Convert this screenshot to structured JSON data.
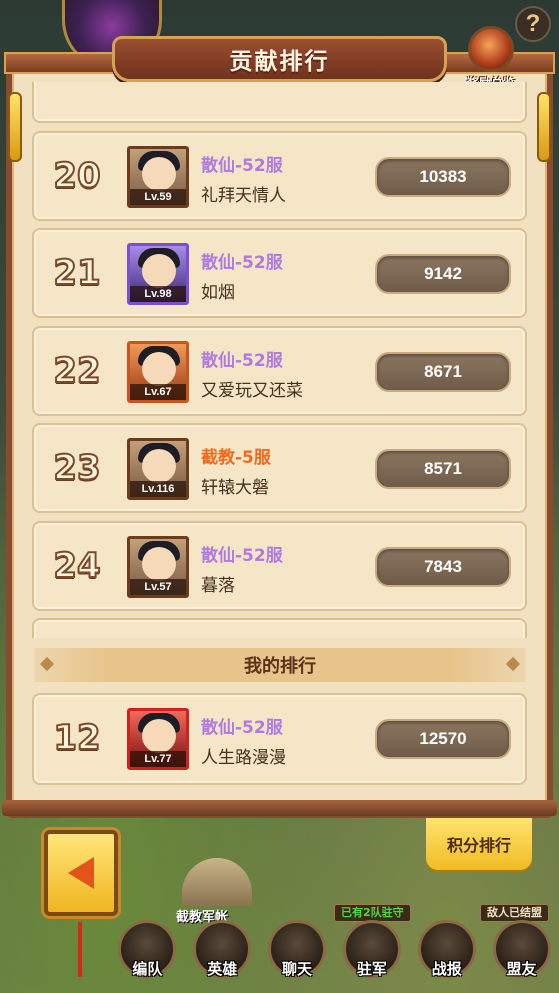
{
  "header": {
    "title": "贡献排行",
    "reward_label": "奖励总览",
    "help_label": "?"
  },
  "ranking": [
    {
      "rank": "20",
      "server": "散仙-52服",
      "server_color": "#b07ae0",
      "name": "礼拜天情人",
      "level": "Lv.59",
      "score": "10383",
      "avatar_style": ""
    },
    {
      "rank": "21",
      "server": "散仙-52服",
      "server_color": "#b07ae0",
      "name": "如烟",
      "level": "Lv.98",
      "score": "9142",
      "avatar_style": "av-purple"
    },
    {
      "rank": "22",
      "server": "散仙-52服",
      "server_color": "#b07ae0",
      "name": "又爱玩又还菜",
      "level": "Lv.67",
      "score": "8671",
      "avatar_style": "av-orange"
    },
    {
      "rank": "23",
      "server": "截教-5服",
      "server_color": "#f06a1e",
      "name": "轩辕大磐",
      "level": "Lv.116",
      "score": "8571",
      "avatar_style": ""
    },
    {
      "rank": "24",
      "server": "散仙-52服",
      "server_color": "#b07ae0",
      "name": "暮落",
      "level": "Lv.57",
      "score": "7843",
      "avatar_style": ""
    }
  ],
  "my_rank": {
    "header": "我的排行",
    "rank": "12",
    "server": "散仙-52服",
    "server_color": "#b07ae0",
    "name": "人生路漫漫",
    "level": "Lv.77",
    "score": "12570"
  },
  "buttons": {
    "score_rank": "积分排行"
  },
  "camp": {
    "label": "截教军帐",
    "tag_garrison": "已有2队驻守",
    "tag_enemy": "敌人已结盟"
  },
  "nav": [
    {
      "label": "编队",
      "icon": "formation-icon"
    },
    {
      "label": "英雄",
      "icon": "hero-icon"
    },
    {
      "label": "聊天",
      "icon": "chat-icon"
    },
    {
      "label": "驻军",
      "icon": "garrison-icon"
    },
    {
      "label": "战报",
      "icon": "battle-report-icon"
    },
    {
      "label": "盟友",
      "icon": "ally-icon"
    }
  ]
}
